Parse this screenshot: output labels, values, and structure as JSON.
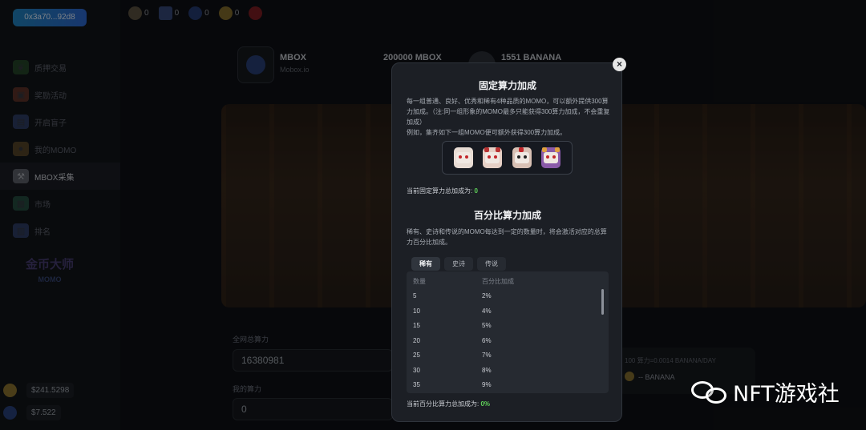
{
  "wallet": {
    "address": "0x3a70...92d8"
  },
  "sidebar": {
    "items": [
      {
        "label": "质押交易",
        "icon": "leaf-icon"
      },
      {
        "label": "奖励活动",
        "icon": "gift-icon"
      },
      {
        "label": "开启盲子",
        "icon": "box-icon"
      },
      {
        "label": "我的MOMO",
        "icon": "momo-icon"
      },
      {
        "label": "MBOX采集",
        "icon": "pickaxe-icon",
        "active": true
      },
      {
        "label": "市场",
        "icon": "market-icon"
      },
      {
        "label": "排名",
        "icon": "chart-icon"
      }
    ],
    "logo_text": "金币大师",
    "logo_sub": "MOMO",
    "balances": [
      {
        "value": "$241.5298",
        "color": "#c6a23a"
      },
      {
        "value": "$7.522",
        "color": "#3355aa"
      }
    ]
  },
  "topbar": {
    "items": [
      {
        "icon": "pickaxe-icon",
        "count": "0",
        "color": "#8a7a5a"
      },
      {
        "icon": "card-icon",
        "count": "0",
        "color": "#4f6bb8"
      },
      {
        "icon": "mbox-icon",
        "count": "0",
        "color": "#3355aa"
      },
      {
        "icon": "coin-icon",
        "count": "0",
        "color": "#c9a53a"
      },
      {
        "icon": "momo-avatar-icon",
        "count": "",
        "color": "#c2262a"
      }
    ]
  },
  "main": {
    "mbox_name": "MBOX",
    "mbox_sub": "Mobox.io",
    "mbox_amount": "200000 MBOX",
    "banana_amount": "1551 BANANA",
    "total_label": "全网总算力",
    "total_value": "16380981",
    "my_label": "我的算力",
    "my_value": "0",
    "rc_line": "100 算力=0.0014 BANANA/DAY",
    "rc_banana": "-- BANANA"
  },
  "modal": {
    "fixed_title": "固定算力加成",
    "fixed_desc1": "每一组普通、良好、优秀和稀有4种品质的MOMO，可以额外提供300算力加成。（注:同一组形象的MOMO最多只能获得300算力加成，不会重复加成）",
    "fixed_desc2": "例如，集齐如下一组MOMO便可额外获得300算力加成。",
    "fixed_total_label": "当前固定算力总加成为:",
    "fixed_total_value": "0",
    "pct_title": "百分比算力加成",
    "pct_desc": "稀有、史诗和传说的MOMO每达到一定的数量时，将会激活对应的总算力百分比加成。",
    "tabs": [
      "稀有",
      "史诗",
      "传说"
    ],
    "table_headers": [
      "数量",
      "百分比加成"
    ],
    "rows": [
      [
        "5",
        "2%"
      ],
      [
        "10",
        "4%"
      ],
      [
        "15",
        "5%"
      ],
      [
        "20",
        "6%"
      ],
      [
        "25",
        "7%"
      ],
      [
        "30",
        "8%"
      ],
      [
        "35",
        "9%"
      ]
    ],
    "pct_total_label": "当前百分比算力总加成为:",
    "pct_total_value": "0%",
    "close": "×"
  },
  "watermark": {
    "text": "NFT游戏社"
  }
}
